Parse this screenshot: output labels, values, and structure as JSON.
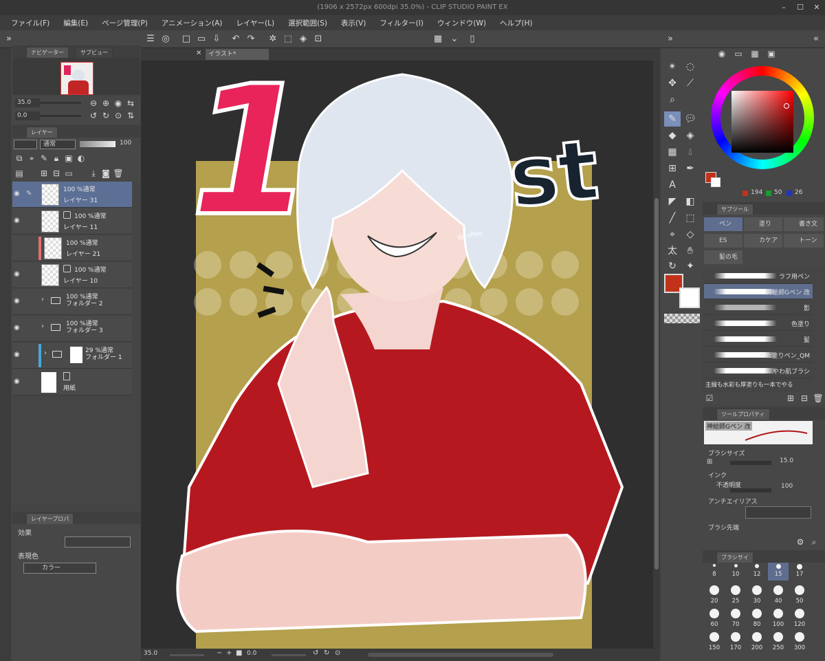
{
  "window": {
    "title": "(1906 x 2572px 600dpi 35.0%)  - CLIP STUDIO PAINT EX"
  },
  "menu": [
    "ファイル(F)",
    "編集(E)",
    "ページ管理(P)",
    "アニメーション(A)",
    "レイヤー(L)",
    "選択範囲(S)",
    "表示(V)",
    "フィルター(I)",
    "ウィンドウ(W)",
    "ヘルプ(H)"
  ],
  "navigator": {
    "tab1": "ナビゲーター",
    "tab2": "サブビュー",
    "zoom": "35.0",
    "angle": "0.0"
  },
  "layers_panel": {
    "tab": "レイヤー",
    "blend_mode": "通常",
    "opacity": "100"
  },
  "layers": [
    {
      "opacity": "100 %通常",
      "name": "レイヤー 31",
      "selected": true
    },
    {
      "opacity": "100 %通常",
      "name": "レイヤー 11"
    },
    {
      "opacity": "100 %通常",
      "name": "レイヤー 21"
    },
    {
      "opacity": "100 %通常",
      "name": "レイヤー 10"
    },
    {
      "opacity": "100 %通常",
      "name": "フォルダー 2"
    },
    {
      "opacity": "100 %通常",
      "name": "フォルダー 3"
    },
    {
      "opacity": "29 %通常",
      "name": "フォルダー 1"
    },
    {
      "opacity": "",
      "name": "用紙"
    }
  ],
  "layer_property": {
    "tab": "レイヤープロパ",
    "effect_label": "効果",
    "color_label": "表現色",
    "color_value": "カラー"
  },
  "document_tab": {
    "label": "イラスト*"
  },
  "artwork": {
    "big_text_1": "1",
    "big_text_2": "st",
    "signature": "@coffee"
  },
  "statusbar": {
    "zoom": "35.0",
    "angle": "0.0"
  },
  "color": {
    "r": "194",
    "g": "50",
    "b": "26",
    "main": "#c2321a"
  },
  "subtool_panel": {
    "tab": "サブツール",
    "tabs": [
      "ペン",
      "塗り",
      "書き文",
      "ES",
      "カケア",
      "トーン",
      "髪の毛"
    ]
  },
  "brushes": [
    {
      "name": "ラフ用ペン"
    },
    {
      "name": "神絵師Gペン 改",
      "selected": true
    },
    {
      "name": "影"
    },
    {
      "name": "色塗り"
    },
    {
      "name": "髪"
    },
    {
      "name": "ベた塗りペン_QM"
    },
    {
      "name": "やわ肌ブラシ"
    }
  ],
  "brush_desc": "主線も水彩も厚塗りも一本でやる",
  "tool_property": {
    "tab": "ツールプロパティ",
    "current": "神絵師Gペン 改",
    "brush_size_label": "ブラシサイズ",
    "brush_size": "15.0",
    "ink_label": "インク",
    "opacity_label": "不透明度",
    "opacity": "100",
    "aa_label": "アンチエイリアス",
    "tip_label": "ブラシ先端"
  },
  "brush_size_panel": {
    "tab": "ブラシサイ",
    "sizes": [
      "8",
      "10",
      "12",
      "15",
      "17",
      "20",
      "25",
      "30",
      "40",
      "50",
      "60",
      "70",
      "80",
      "100",
      "120",
      "150",
      "170",
      "200",
      "250",
      "300"
    ],
    "selected": "15"
  }
}
